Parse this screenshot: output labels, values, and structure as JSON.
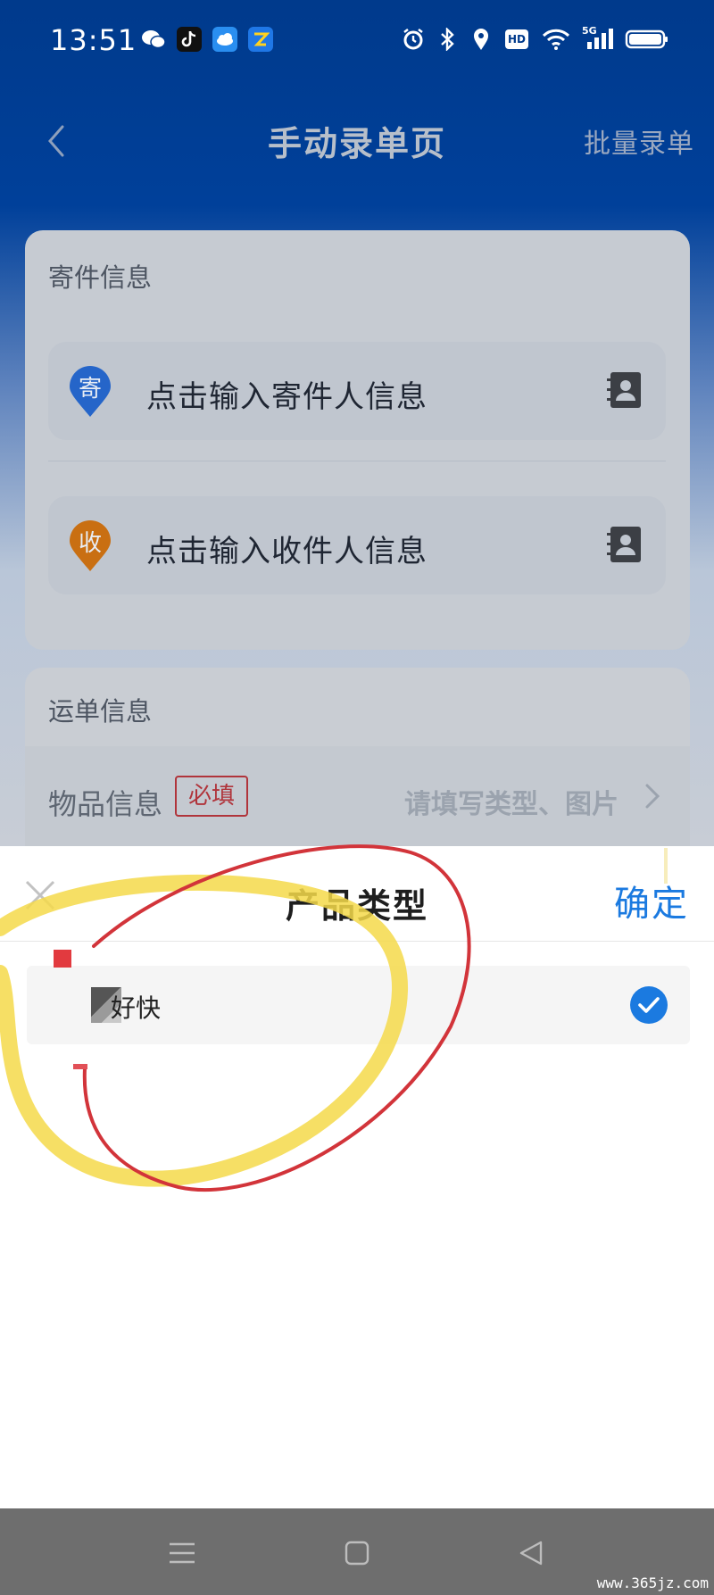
{
  "status_bar": {
    "time": "13:51",
    "notification_icons": [
      "wechat-icon",
      "tiktok-icon",
      "weather-icon",
      "express-app-icon"
    ],
    "system_icons": [
      "alarm-icon",
      "bluetooth-icon",
      "location-icon",
      "hd-icon",
      "wifi-icon",
      "signal-5g-icon",
      "battery-icon"
    ],
    "hd_label": "HD",
    "network_label": "5G"
  },
  "nav": {
    "title": "手动录单页",
    "action": "批量录单"
  },
  "sender_card": {
    "heading": "寄件信息",
    "sender": {
      "pin_label": "寄",
      "text": "点击输入寄件人信息",
      "pin_color": "#2565c9"
    },
    "receiver": {
      "pin_label": "收",
      "text": "点击输入收件人信息",
      "pin_color": "#c96f12"
    }
  },
  "waybill_card": {
    "heading": "运单信息",
    "item_label": "物品信息",
    "required_label": "必填",
    "item_placeholder": "请填写类型、图片"
  },
  "sheet": {
    "title": "产品类型",
    "confirm": "确定",
    "options": [
      {
        "label": "好快",
        "selected": true
      }
    ],
    "accent": "#1b7ae0"
  },
  "system_nav": {
    "buttons": [
      "menu-icon",
      "home-icon",
      "back-icon"
    ]
  },
  "watermark": "www.365jz.com"
}
